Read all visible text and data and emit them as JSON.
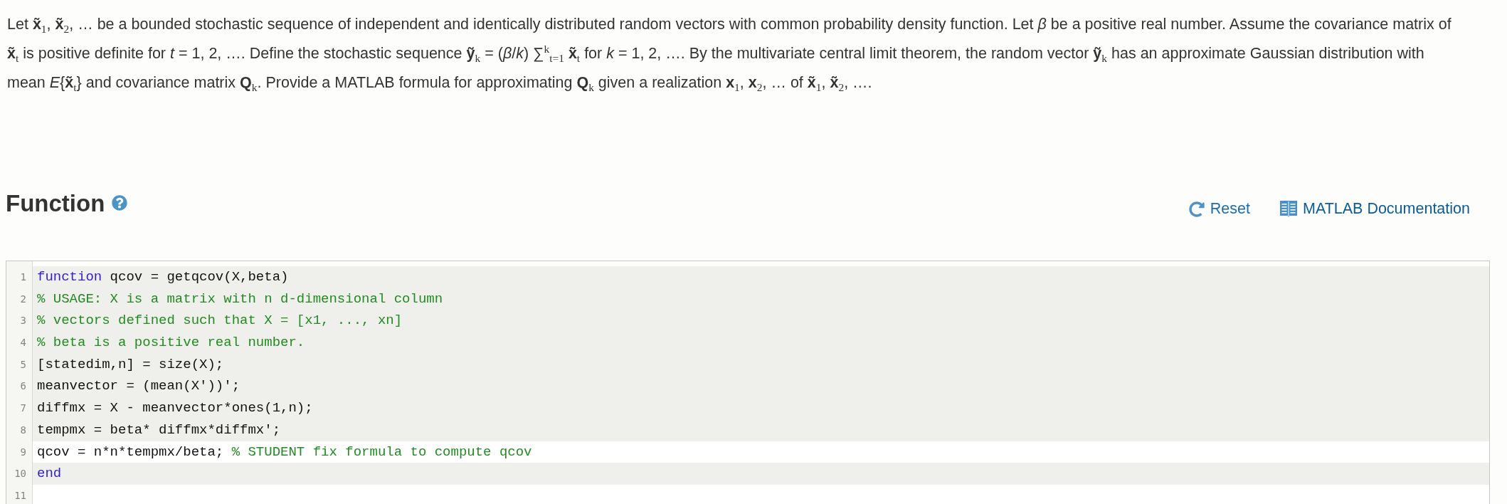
{
  "problem": {
    "text": "Let **x̃**$_{1}$, **x̃**$_{2}$, … be a bounded stochastic sequence of independent and identically distributed random vectors with common probability density function. Let *β* be a positive real number. Assume the covariance matrix of **x̃**$_{t}$ is positive definite for *t* = 1, 2, …. Define the stochastic sequence **ỹ**$_{k}$ = (*β*/*k*) ∑$^{k}$$_{t=1}$ **x̃**$_{t}$ for *k* = 1, 2, …. By the multivariate central limit theorem, the random vector **ỹ**$_{k}$ has an approximate Gaussian distribution with mean *E*{**x̃**$_{t}$} and covariance matrix **Q**$_{k}$. Provide a MATLAB formula for approximating **Q**$_{k}$ given a realization **x**$_{1}$, **x**$_{2}$, … of **x̃**$_{1}$, **x̃**$_{2}$, …."
  },
  "function_section": {
    "title": "Function",
    "reset_label": "Reset",
    "docs_label": "MATLAB Documentation"
  },
  "editor": {
    "lines": [
      {
        "number": "1",
        "editable": false,
        "tokens": [
          {
            "kind": "keyword",
            "text": "function"
          },
          {
            "kind": "plain",
            "text": " qcov = getqcov(X,beta)"
          }
        ]
      },
      {
        "number": "2",
        "editable": false,
        "tokens": [
          {
            "kind": "comment",
            "text": "% USAGE: X is a matrix with n d-dimensional column"
          }
        ]
      },
      {
        "number": "3",
        "editable": false,
        "tokens": [
          {
            "kind": "comment",
            "text": "% vectors defined such that X = [x1, ..., xn]"
          }
        ]
      },
      {
        "number": "4",
        "editable": false,
        "tokens": [
          {
            "kind": "comment",
            "text": "% beta is a positive real number."
          }
        ]
      },
      {
        "number": "5",
        "editable": false,
        "tokens": [
          {
            "kind": "plain",
            "text": "[statedim,n] = size(X);"
          }
        ]
      },
      {
        "number": "6",
        "editable": false,
        "tokens": [
          {
            "kind": "plain",
            "text": "meanvector = (mean(X'))';"
          }
        ]
      },
      {
        "number": "7",
        "editable": false,
        "tokens": [
          {
            "kind": "plain",
            "text": "diffmx = X - meanvector*ones(1,n);"
          }
        ]
      },
      {
        "number": "8",
        "editable": false,
        "tokens": [
          {
            "kind": "plain",
            "text": "tempmx = beta* diffmx*diffmx';"
          }
        ]
      },
      {
        "number": "9",
        "editable": true,
        "tokens": [
          {
            "kind": "plain",
            "text": "qcov = n*n*tempmx/beta; "
          },
          {
            "kind": "comment",
            "text": "% STUDENT fix formula to compute qcov"
          }
        ]
      },
      {
        "number": "10",
        "editable": false,
        "tokens": [
          {
            "kind": "keyword",
            "text": "end"
          }
        ]
      },
      {
        "number": "11",
        "editable": true
      }
    ]
  }
}
